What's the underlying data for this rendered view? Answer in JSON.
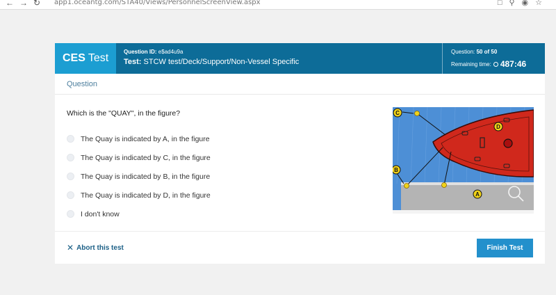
{
  "browser": {
    "url": "app1.oceantg.com/STA40/Views/PersonnelScreenView.aspx"
  },
  "header": {
    "brand_bold": "CES",
    "brand_rest": "Test",
    "question_id_label": "Question ID:",
    "question_id": "e$ad4u9a",
    "test_label": "Test:",
    "test_name": "STCW test/Deck/Support/Non-Vessel Specific",
    "question_label": "Question:",
    "question_progress": "50 of 50",
    "remaining_label": "Remaining time:",
    "remaining_time": "487:46"
  },
  "section": {
    "title": "Question"
  },
  "question": {
    "text": "Which is the \"QUAY\", in the figure?",
    "options": [
      "The Quay is indicated by A, in the figure",
      "The Quay is indicated by C, in the figure",
      "The Quay is indicated by B, in the figure",
      "The Quay is indicated by D, in the figure",
      "I don't know"
    ]
  },
  "figure": {
    "labels": [
      "C",
      "D",
      "B",
      "A"
    ]
  },
  "footer": {
    "abort_label": "Abort this test",
    "finish_label": "Finish Test"
  },
  "colors": {
    "header_bg": "#0d6c98",
    "brand_bg": "#1c9ed2",
    "button_bg": "#2390cc",
    "ship_red": "#d0281c",
    "water_blue": "#4d8fd6"
  }
}
